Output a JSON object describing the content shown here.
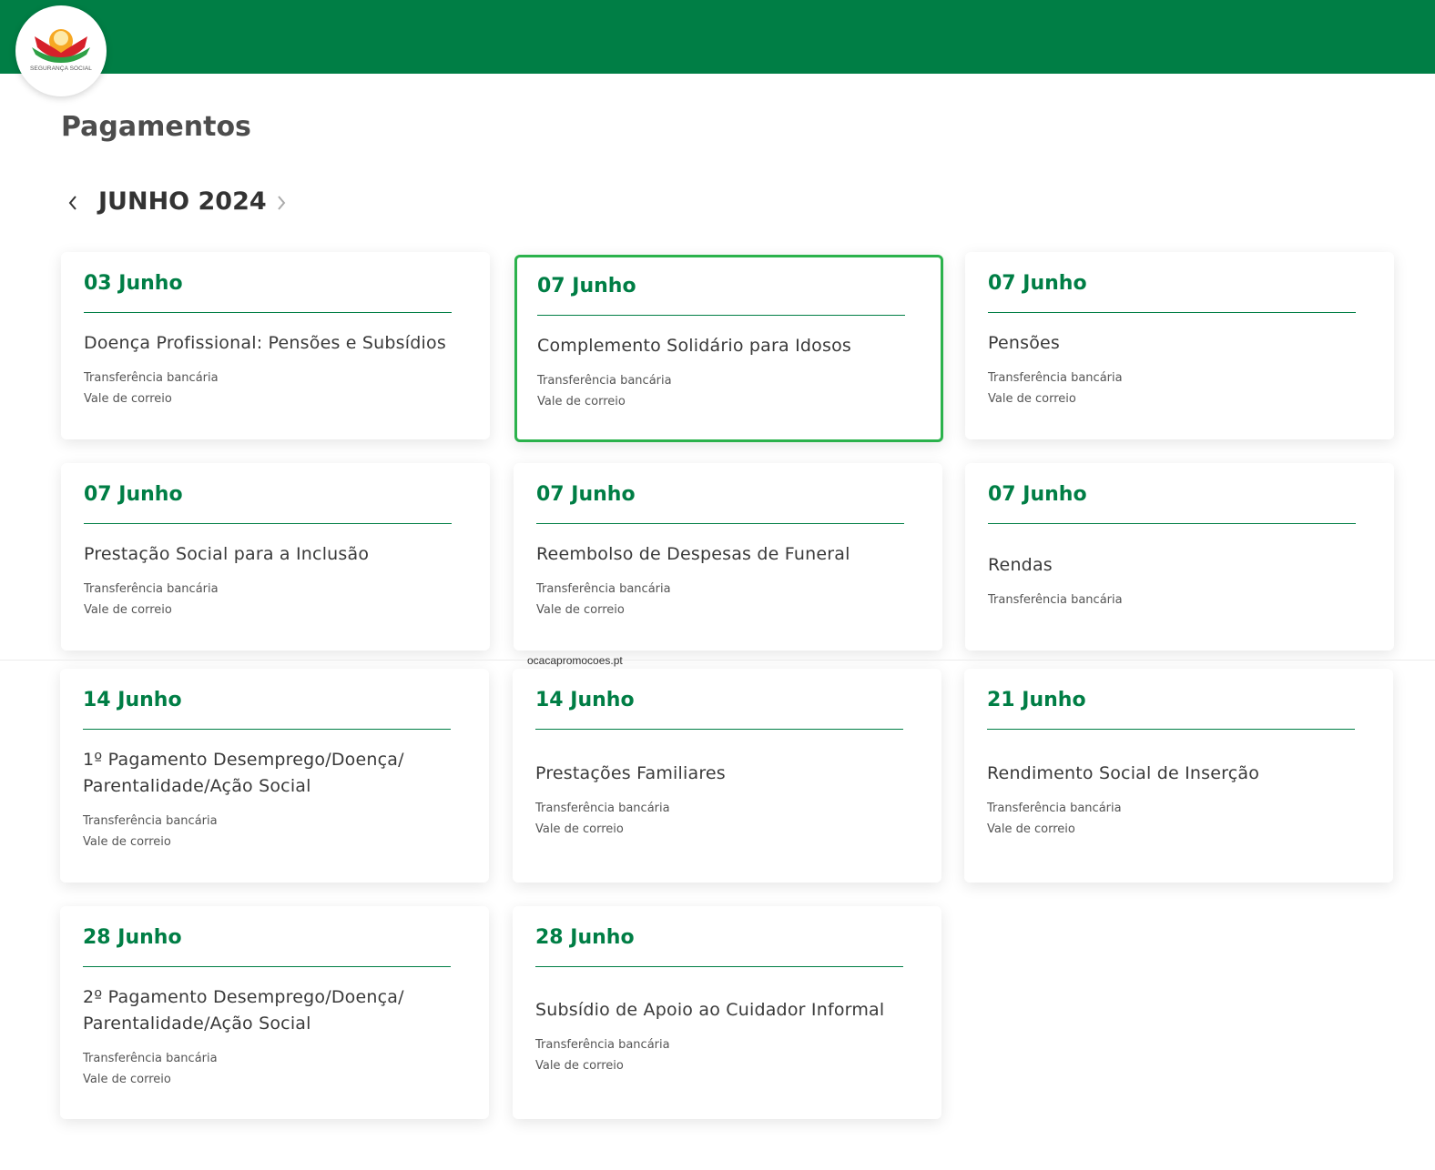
{
  "header": {
    "logo": {
      "icon": "seguranca-social-logo-icon",
      "text": "SEGURANÇA SOCIAL"
    },
    "colors": {
      "topbar": "#007e45",
      "accent": "#007e45",
      "selected_border": "#2bb24c"
    }
  },
  "page": {
    "title": "Pagamentos",
    "month_nav": {
      "prev_icon": "chevron-left-icon",
      "label": "JUNHO 2024",
      "next_icon": "chevron-right-icon"
    }
  },
  "cards": [
    {
      "date": "03 Junho",
      "title": "Doença Profissional: Pensões e Subsídios",
      "methods": [
        "Transferência bancária",
        "Vale de correio"
      ]
    },
    {
      "date": "07 Junho",
      "title": "Complemento Solidário para Idosos",
      "methods": [
        "Transferência bancária",
        "Vale de correio"
      ],
      "selected": true
    },
    {
      "date": "07 Junho",
      "title": "Pensões",
      "methods": [
        "Transferência bancária",
        "Vale de correio"
      ]
    },
    {
      "date": "07 Junho",
      "title": "Prestação Social para a Inclusão",
      "methods": [
        "Transferência bancária",
        "Vale de correio"
      ]
    },
    {
      "date": "07 Junho",
      "title": "Reembolso de Despesas de Funeral",
      "methods": [
        "Transferência bancária",
        "Vale de correio"
      ]
    },
    {
      "date": "07 Junho",
      "title": "Rendas",
      "methods": [
        "Transferência bancária"
      ]
    },
    {
      "date": "14 Junho",
      "title": "1º Pagamento Desemprego/Doença/ Parentalidade/Ação Social",
      "methods": [
        "Transferência bancária",
        "Vale de correio"
      ]
    },
    {
      "date": "14 Junho",
      "title": "Prestações Familiares",
      "methods": [
        "Transferência bancária",
        "Vale de correio"
      ]
    },
    {
      "date": "21 Junho",
      "title": "Rendimento Social de Inserção",
      "methods": [
        "Transferência bancária",
        "Vale de correio"
      ]
    },
    {
      "date": "28 Junho",
      "title": "2º Pagamento Desemprego/Doença/ Parentalidade/Ação Social",
      "methods": [
        "Transferência bancária",
        "Vale de correio"
      ]
    },
    {
      "date": "28 Junho",
      "title": "Subsídio de Apoio ao Cuidador Informal",
      "methods": [
        "Transferência bancária",
        "Vale de correio"
      ]
    }
  ],
  "watermark": "ocacapromocoes.pt"
}
